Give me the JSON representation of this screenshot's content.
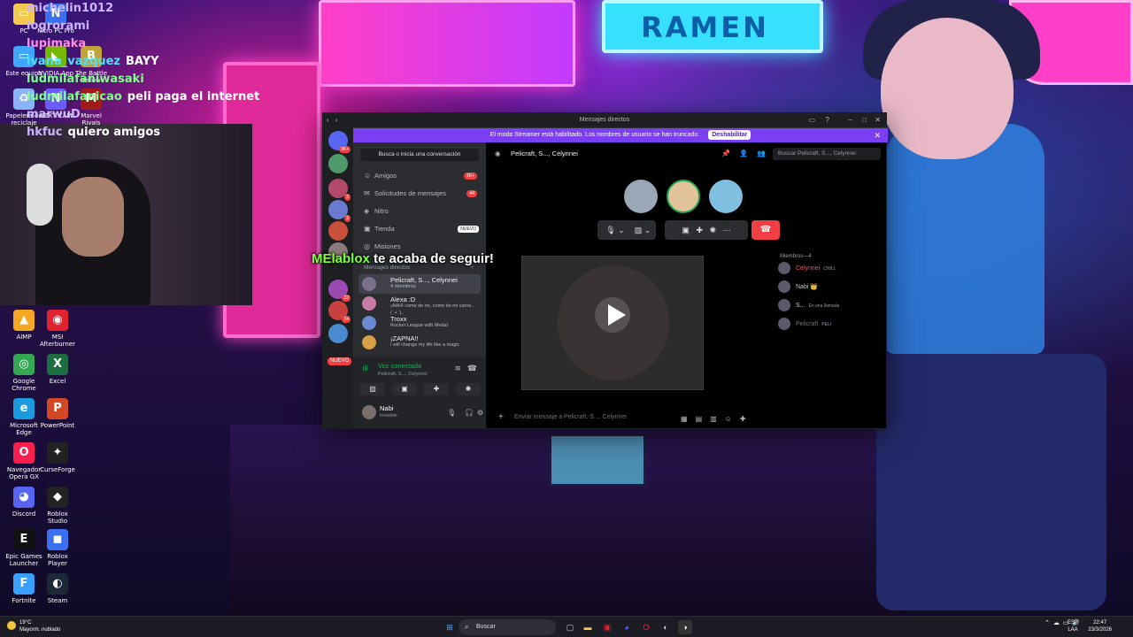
{
  "desktop": {
    "icons": [
      {
        "label": "PC",
        "glyph": "▭",
        "color": "#f2c94c"
      },
      {
        "label": "Nitro PC Pro",
        "glyph": "N",
        "color": "#3a6ff0"
      },
      {
        "label": "Este equipo",
        "glyph": "▭",
        "color": "#3ea6ff"
      },
      {
        "label": "NVIDIA App",
        "glyph": "◣",
        "color": "#76b900"
      },
      {
        "label": "The Battle Yellow",
        "glyph": "B",
        "color": "#c2a33a"
      },
      {
        "label": "Papelera de reciclaje",
        "glyph": "♻",
        "color": "#8ab4f8"
      },
      {
        "label": "NZXT CAM",
        "glyph": "N",
        "color": "#6a5cff"
      },
      {
        "label": "Marvel Rivals",
        "glyph": "M",
        "color": "#a31a1a"
      },
      {
        "label": "AIMP",
        "glyph": "▲",
        "color": "#f5a623"
      },
      {
        "label": "MSI Afterburner",
        "glyph": "◉",
        "color": "#e0232e"
      },
      {
        "label": "Google Chrome",
        "glyph": "◎",
        "color": "#34a853"
      },
      {
        "label": "Excel",
        "glyph": "X",
        "color": "#1d6f42"
      },
      {
        "label": "Microsoft Edge",
        "glyph": "e",
        "color": "#1a9be0"
      },
      {
        "label": "PowerPoint",
        "glyph": "P",
        "color": "#d24726"
      },
      {
        "label": "Navegador Opera GX",
        "glyph": "O",
        "color": "#fa1e4e"
      },
      {
        "label": "CurseForge",
        "glyph": "✦",
        "color": "#222222"
      },
      {
        "label": "Discord",
        "glyph": "◕",
        "color": "#5865f2"
      },
      {
        "label": "Roblox Studio",
        "glyph": "◆",
        "color": "#222222"
      },
      {
        "label": "Epic Games Launcher",
        "glyph": "E",
        "color": "#111111"
      },
      {
        "label": "Roblox Player",
        "glyph": "◼",
        "color": "#3a6ff0"
      },
      {
        "label": "Fortnite",
        "glyph": "F",
        "color": "#3aa0ff"
      },
      {
        "label": "Steam",
        "glyph": "◐",
        "color": "#1b2838"
      }
    ]
  },
  "chat": {
    "lines": [
      {
        "user": "michelin1012",
        "msg": "",
        "cls": "c-user"
      },
      {
        "user": "logrorami",
        "msg": "",
        "cls": "c-user"
      },
      {
        "user": "lupimaka",
        "msg": "",
        "cls": "c-user pink"
      },
      {
        "user": "ivana_vazquez",
        "msg": "BAYY",
        "cls": "c-user cyan"
      },
      {
        "user": "ludmilafaniwasaki",
        "msg": "",
        "cls": "c-user green"
      },
      {
        "user": "ludmilafanicao",
        "msg": "peli paga el internet",
        "cls": "c-user green"
      },
      {
        "user": "marwuD",
        "msg": "",
        "cls": "c-user"
      },
      {
        "user": "hkfuc",
        "msg": "quiero amigos",
        "cls": "c-user"
      }
    ]
  },
  "discord": {
    "title": "Mensajes directos",
    "banner": {
      "text": "El modo Streamer está habilitado. Los nombres de usuario se han truncado.",
      "button": "Deshabilitar"
    },
    "guild_new": "NUEVO",
    "guild_badges": [
      "9K+",
      "",
      "3",
      "2",
      "",
      "",
      "22",
      "24",
      ""
    ],
    "search_placeholder": "Busca o inicia una conversación",
    "nav": [
      {
        "label": "Amigos",
        "icon": "☺",
        "badge": "1K+"
      },
      {
        "label": "Solicitudes de mensajes",
        "icon": "✉",
        "badge": "44"
      },
      {
        "label": "Nitro",
        "icon": "◈",
        "badge": ""
      },
      {
        "label": "Tienda",
        "icon": "▣",
        "new": "NUEVO"
      },
      {
        "label": "Misiones",
        "icon": "◎",
        "badge": ""
      }
    ],
    "dm_header": "Mensajes directos",
    "dms": [
      {
        "name": "Pelicraft, S..., Celynnei",
        "status": "4 miembros",
        "color": "#7c6f8a"
      },
      {
        "name": "Alexa :D",
        "status": "¡AAH! come de mi, come de mi carne..(´ㅅ`)..",
        "color": "#c97ca8"
      },
      {
        "name": "Troxx",
        "status": "Rocket League with Medal",
        "color": "#6a8acf"
      },
      {
        "name": "¡ZAPNA!!",
        "status": "I will change my life like a magic",
        "color": "#d9a04a"
      }
    ],
    "voice": {
      "status": "Voz conectada",
      "channel": "Pelicraft, S..., Celynnei"
    },
    "user": {
      "name": "Nabi",
      "status": "Invisible"
    },
    "main": {
      "header": "Pelicraft, S..., Celynnei",
      "search": "Buscar Pelicraft, S..., Celynnei",
      "members_header": "Miembros—4",
      "members": [
        {
          "name": "Celynnei",
          "tag": "CHILL",
          "color": "#e06060"
        },
        {
          "name": "Nabi 👑",
          "tag": "",
          "color": "#c9c9c9"
        },
        {
          "name": "S...",
          "tag": "En una llamada",
          "color": "#c9c9c9"
        },
        {
          "name": "Pelicraft",
          "tag": "PELI",
          "color": "#6d6f78"
        }
      ],
      "message_placeholder": "Enviar mensaje a Pelicraft, S..., Celynnei"
    }
  },
  "alert": {
    "name": "MElablox",
    "text": " te acaba de seguir!"
  },
  "taskbar": {
    "weather_temp": "19°C",
    "weather_desc": "Mayorm. nublado",
    "search": "Buscar",
    "lang": "ESP",
    "lang2": "LAA",
    "time": "22:47",
    "date": "23/3/2026"
  }
}
